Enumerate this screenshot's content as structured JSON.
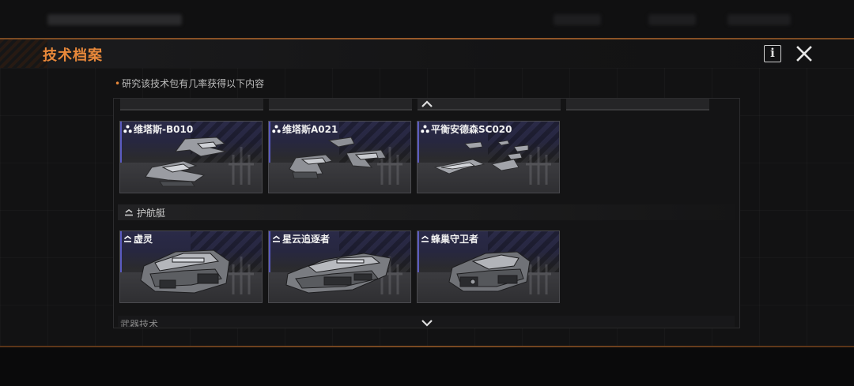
{
  "header": {
    "title": "技术档案",
    "info_label": "i"
  },
  "note": "研究该技术包有几率获得以下内容",
  "groups": [
    {
      "name": "",
      "items": [
        {
          "name": "维塔斯-B010",
          "icon": "tri-dot-icon"
        },
        {
          "name": "维塔斯A021",
          "icon": "tri-dot-icon"
        },
        {
          "name": "平衡安德森SC020",
          "icon": "tri-dot-icon"
        }
      ]
    },
    {
      "name": "护航艇",
      "items": [
        {
          "name": "虚灵",
          "icon": "chevron-stack-icon"
        },
        {
          "name": "星云追逐者",
          "icon": "chevron-stack-icon"
        },
        {
          "name": "蜂巢守卫者",
          "icon": "chevron-stack-icon"
        }
      ]
    }
  ],
  "next_section": "武器技术",
  "colors": {
    "accent": "#e8883a",
    "card_top": "#2a2a48",
    "card_stripe": "#5a5ac0"
  }
}
